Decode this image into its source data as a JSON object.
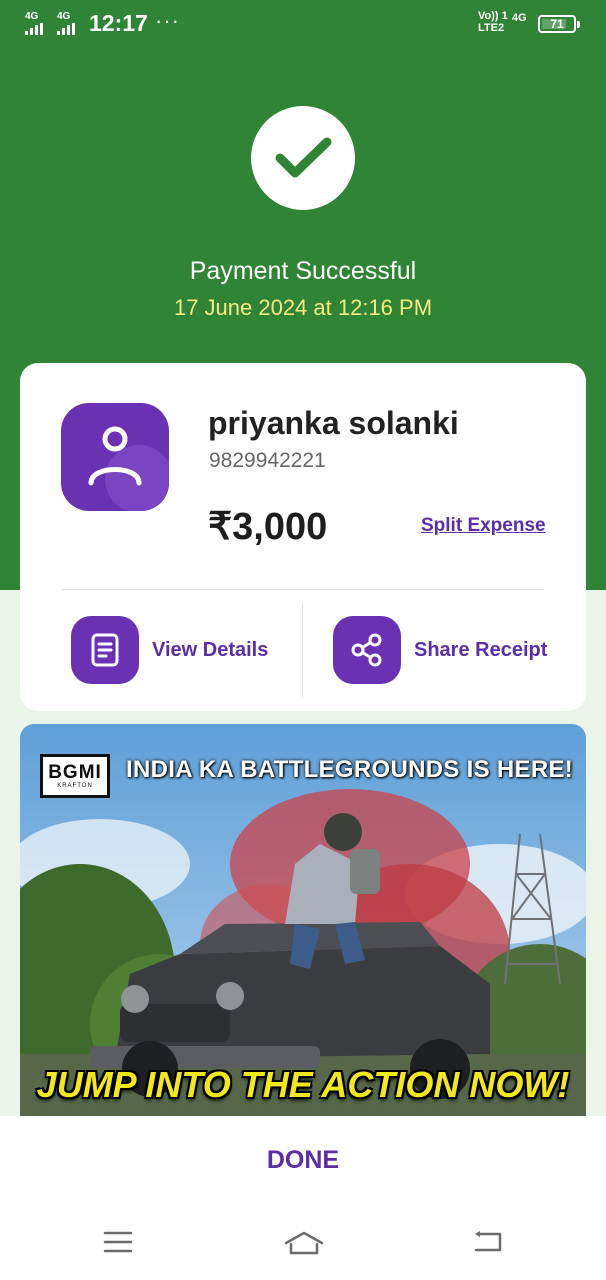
{
  "status_bar": {
    "sim1_network": "4G",
    "sim2_network": "4G",
    "time": "12:17",
    "more": "···",
    "volte_top": "Vo))",
    "volte_bottom": "LTE2",
    "sim_index": "1",
    "data_network": "4G",
    "battery_level": "71"
  },
  "header": {
    "status_icon": "checkmark-icon",
    "title": "Payment Successful",
    "datetime": "17 June 2024 at 12:16 PM"
  },
  "payee": {
    "avatar_icon": "user-icon",
    "name": "priyanka solanki",
    "phone": "9829942221",
    "amount": "₹3,000",
    "split_label": "Split Expense"
  },
  "actions": {
    "view_details": {
      "label": "View Details",
      "icon": "document-icon"
    },
    "share_receipt": {
      "label": "Share Receipt",
      "icon": "share-icon"
    }
  },
  "banner": {
    "logo_text": "BGMI",
    "logo_subtext": "KRAFTON",
    "headline": "INDIA KA BATTLEGROUNDS IS HERE!",
    "cta": "JUMP INTO THE ACTION NOW!"
  },
  "footer": {
    "done_label": "DONE"
  },
  "navigation": {
    "menu_icon": "menu-icon",
    "home_icon": "home-icon",
    "back_icon": "back-icon"
  },
  "colors": {
    "success_green": "#2f8436",
    "brand_purple": "#6a31b3",
    "link_purple": "#5b2da6",
    "date_yellow": "#f7ea7e"
  }
}
